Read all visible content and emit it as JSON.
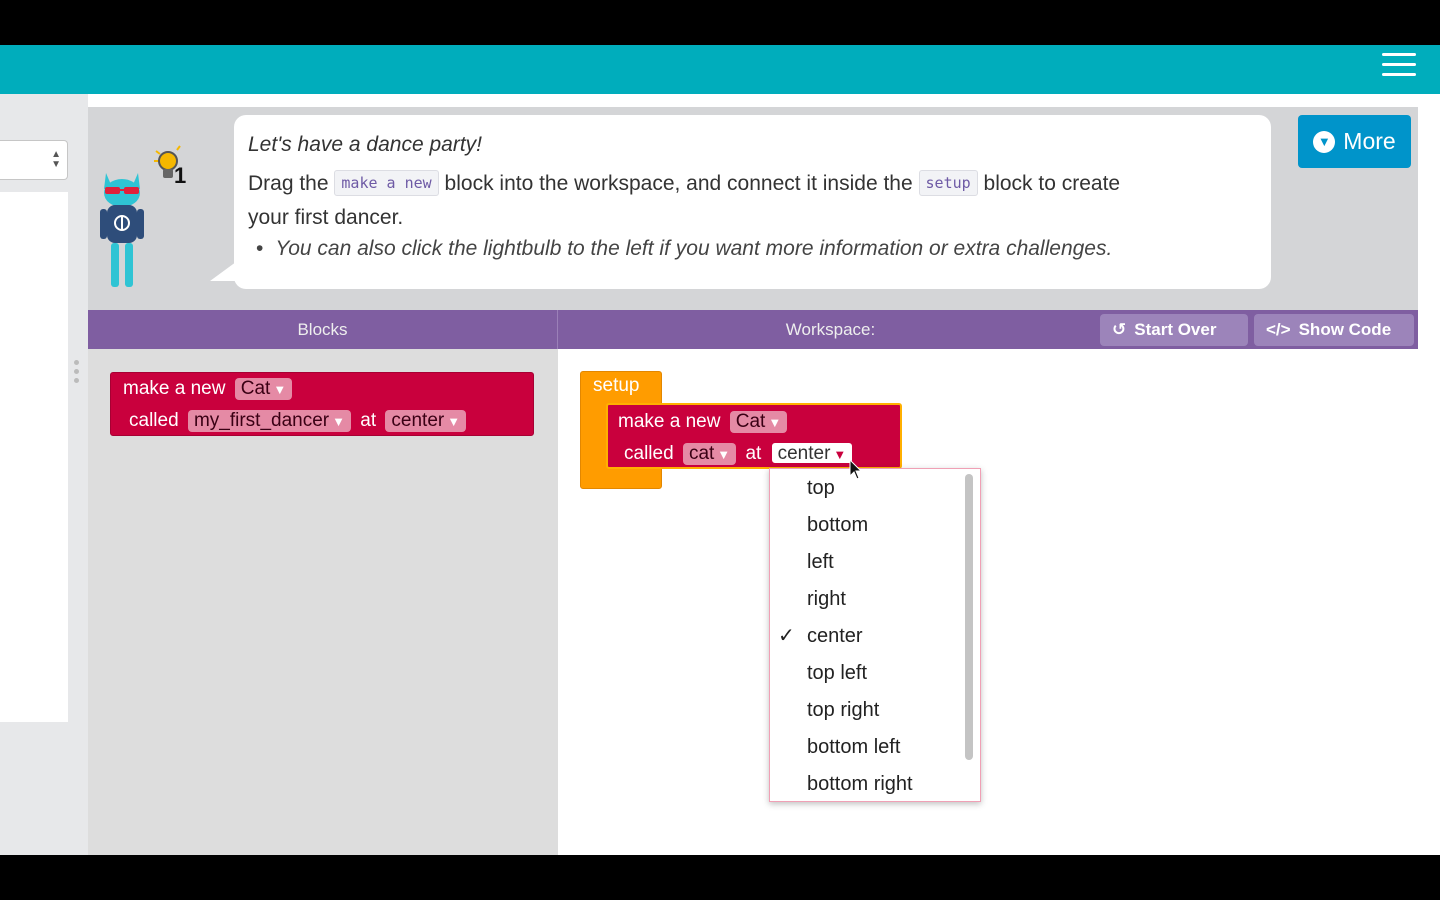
{
  "header": {
    "menu_icon": "hamburger-icon",
    "color": "#00adbc"
  },
  "instructions": {
    "hint_count": "1",
    "title": "Let's have a dance party!",
    "line1_pre": "Drag the",
    "chip1": "make a new",
    "line1_mid": "block into the workspace, and connect it inside the",
    "chip2": "setup",
    "line1_post": "block to create",
    "line2": "your first dancer.",
    "bullet": "You can also click the lightbulb to the left if you want more information or extra challenges."
  },
  "more_button": {
    "label": "More",
    "icon": "chevron-down-circle-icon"
  },
  "toolbar": {
    "blocks_label": "Blocks",
    "workspace_label": "Workspace:",
    "start_over_label": "Start Over",
    "start_over_icon": "reset-icon",
    "show_code_label": "Show Code",
    "show_code_icon": "code-icon"
  },
  "toolbox_block": {
    "make_label": "make a new",
    "type_value": "Cat",
    "called_label": "called",
    "name_value": "my_first_dancer",
    "at_label": "at",
    "position_value": "center"
  },
  "workspace_block": {
    "setup_label": "setup",
    "make_label": "make a new",
    "type_value": "Cat",
    "called_label": "called",
    "name_value": "cat",
    "at_label": "at",
    "position_value": "center"
  },
  "dropdown": {
    "selected": "center",
    "options": [
      "top",
      "bottom",
      "left",
      "right",
      "center",
      "top left",
      "top right",
      "bottom left",
      "bottom right"
    ]
  },
  "colors": {
    "block_red": "#c9003d",
    "setup_orange": "#ff9c00",
    "purple_bar": "#7f5ea1",
    "more_blue": "#0094ca"
  }
}
